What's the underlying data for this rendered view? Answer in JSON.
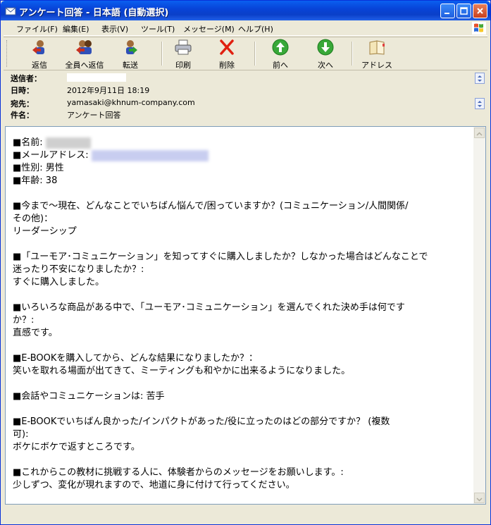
{
  "window": {
    "title": "アンケート回答 - 日本語 (自動選択)"
  },
  "menu": [
    {
      "label": "ファイル(F)"
    },
    {
      "label": "編集(E)"
    },
    {
      "label": "表示(V)"
    },
    {
      "label": "ツール(T)"
    },
    {
      "label": "メッセージ(M)"
    },
    {
      "label": "ヘルプ(H)"
    }
  ],
  "toolbar": {
    "reply": "返信",
    "reply_all": "全員へ返信",
    "forward": "転送",
    "print": "印刷",
    "delete": "削除",
    "previous": "前へ",
    "next": "次へ",
    "addresses": "アドレス"
  },
  "header": {
    "from_label": "送信者：",
    "from_value": "",
    "date_label": "日時：",
    "date_value": "2012年9月11日 18:19",
    "to_label": "宛先：",
    "to_value": "yamasaki@khnum-company.com",
    "subject_label": "件名：",
    "subject_value": "アンケート回答"
  },
  "message": {
    "line01": "■名前: ",
    "line02": "■メールアドレス: ",
    "line03": "■性別: 男性",
    "line04": "■年齢: 38",
    "line06": "■今まで～現在、どんなことでいちばん悩んで/困っていますか？(コミュニケーション/人間関係/",
    "line07": "その他)：",
    "line08": "リーダーシップ",
    "line10": "■「ユーモア･コミュニケーション」を知ってすぐに購入しましたか？しなかった場合はどんなことで",
    "line11": "迷ったり不安になりましたか？:",
    "line12": "すぐに購入しました。",
    "line14": "■いろいろな商品がある中で、「ユーモア･コミュニケーション」を選んでくれた決め手は何です",
    "line15": "か？:",
    "line16": "直感です。",
    "line18": "■E-BOOKを購入してから、どんな結果になりましたか？：",
    "line19": "笑いを取れる場面が出てきて、ミーティングも和やかに出来るようになりました。",
    "line21": "■会話やコミュニケーションは: 苦手",
    "line23": "■E-BOOKでいちばん良かった/インパクトがあった/役に立ったのはどの部分ですか？ (複数",
    "line24": "可):",
    "line25": "ボケにボケで返すところです。",
    "line27": "■これからこの教材に挑戦する人に、体験者からのメッセージをお願いします。:",
    "line28": "少しずつ、変化が現れますので、地道に身に付けて行ってください。"
  }
}
